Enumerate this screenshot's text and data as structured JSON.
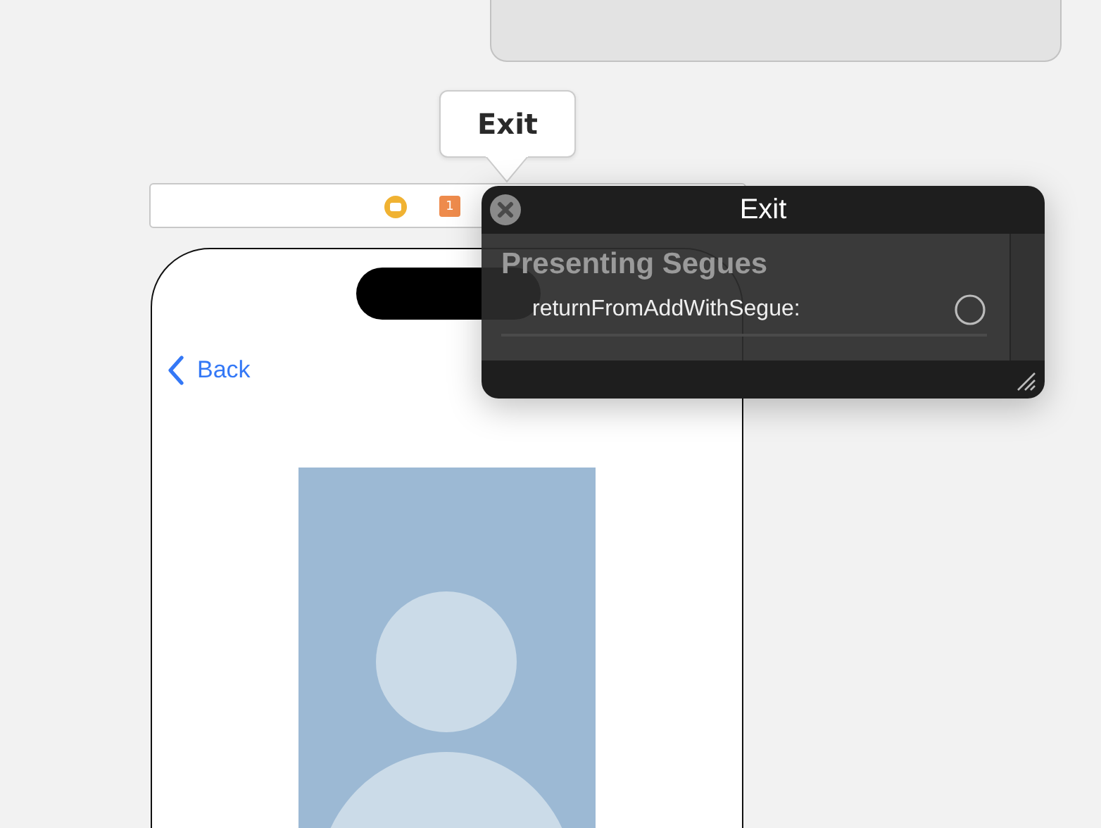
{
  "tooltip": {
    "text": "Exit"
  },
  "scene_bar": {
    "badge": "1"
  },
  "phone": {
    "back_label": "Back"
  },
  "popover": {
    "title": "Exit",
    "section": "Presenting Segues",
    "actions": [
      {
        "label": "returnFromAddWithSegue:"
      }
    ]
  }
}
